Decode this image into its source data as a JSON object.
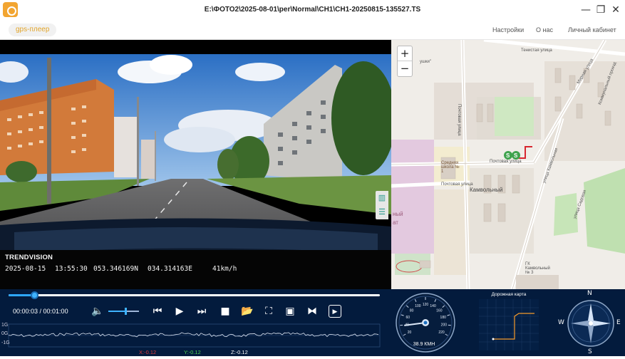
{
  "window": {
    "title": "E:\\ФОТО2\\2025-08-01\\per\\Normal\\CH1\\CH1-20250815-135527.TS",
    "minimize_glyph": "—",
    "maximize_glyph": "❐",
    "close_glyph": "✕"
  },
  "menu": {
    "tab_label": "gps-плеер",
    "links": [
      "Настройки",
      "О нас",
      "Личный кабинет"
    ]
  },
  "video": {
    "brand": "TRENDVISION",
    "date": "2025-08-15",
    "time": "13:55:30",
    "latitude": "053.346169N",
    "longitude": "034.314163E",
    "speed": "41km/h"
  },
  "map": {
    "zoom_in": "+",
    "zoom_out": "−",
    "labels": {
      "teni": "Тенистая улица",
      "pochtovaya1": "Почтовая улица",
      "pochtovaya2": "Почтовая улица",
      "pochtovaya3": "Почтовая улица",
      "school": "Средняя школа № 1",
      "district": "Камвольный",
      "kambolnaya": "улица Камвольная",
      "mirnaya": "Мирная улица",
      "gk": "ГК Камвольный № 3",
      "kommun": "Коммунальный проезд",
      "sadovaya": "улица Садовая",
      "fragment1": "ушки\"",
      "fragment2": "ный",
      "fragment3": "ат"
    },
    "accent_marker": "#3fa34d",
    "route_color": "#d7262f"
  },
  "playback": {
    "time_current": "00:00:03",
    "time_total": "00:01:00",
    "time_display": "00:00:03 / 00:01:00",
    "progress_fraction": 0.07,
    "volume_fraction": 0.55
  },
  "controls": [
    {
      "name": "volume-icon",
      "glyph": "🔈"
    },
    {
      "name": "skip-back-icon",
      "glyph": "⏮"
    },
    {
      "name": "play-icon",
      "glyph": "▶"
    },
    {
      "name": "skip-forward-icon",
      "glyph": "⏭"
    },
    {
      "name": "stop-icon",
      "glyph": "■"
    },
    {
      "name": "folder-icon",
      "glyph": "📂"
    },
    {
      "name": "crop-icon",
      "glyph": "⛶"
    },
    {
      "name": "screenshot-icon",
      "glyph": "▣"
    },
    {
      "name": "split-view-icon",
      "glyph": "⧓"
    },
    {
      "name": "video-record-icon",
      "glyph": "▶"
    }
  ],
  "gsensor": {
    "y_labels": [
      "1G",
      "0G",
      "-1G"
    ],
    "x_value": "X:-0.12",
    "y_value": "Y:-0.12",
    "z_value": "Z:-0.12",
    "x_color": "#e23b3b",
    "y_color": "#4fd14f",
    "z_color": "#ffffff"
  },
  "speedometer": {
    "value": 38.9,
    "label": "38.9 КМН",
    "ticks": [
      "20",
      "40",
      "60",
      "80",
      "100",
      "120",
      "140",
      "160",
      "180",
      "200",
      "220"
    ]
  },
  "track_map": {
    "title": "Дорожная карта",
    "route_color": "#f39a2b"
  },
  "compass": {
    "n": "N",
    "s": "S",
    "e": "E",
    "w": "W"
  },
  "colors": {
    "panel_bg": "#031b3d",
    "accent": "#2ea8ff",
    "tab_text": "#e2a52a"
  }
}
